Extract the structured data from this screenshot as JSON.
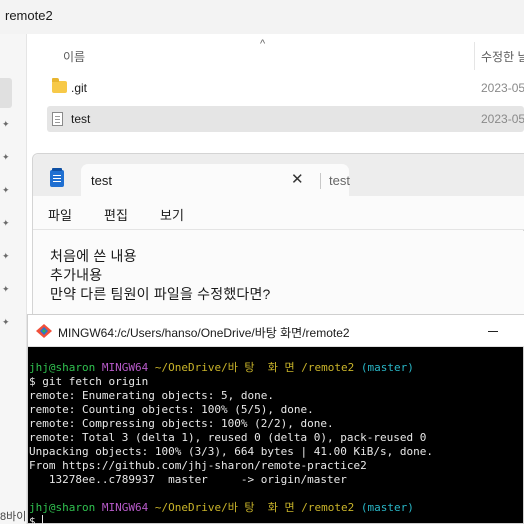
{
  "explorer": {
    "title": "remote2",
    "col_name": "이름",
    "col_modified": "수정한 날",
    "sort_caret": "^",
    "rows": [
      {
        "name": ".git",
        "date": "2023-05",
        "icon": "folder-icon"
      },
      {
        "name": "test",
        "date": "2023-05",
        "icon": "text-file-icon"
      }
    ],
    "nav_bottom_text": "8바이"
  },
  "notepad": {
    "tab_active": "test",
    "tab_close": "✕",
    "tab_inactive": "test",
    "menu": [
      "파일",
      "편집",
      "보기"
    ],
    "lines": [
      "처음에 쓴 내용",
      "추가내용",
      "만약 다른 팀원이 파일을 수정했다면?"
    ]
  },
  "terminal": {
    "title": "MINGW64:/c/Users/hanso/OneDrive/바탕 화면/remote2",
    "prompt_user": "jhj@sharon",
    "prompt_sys": "MINGW64",
    "prompt_path": "~/OneDrive/바 탕  화 면 /remote2",
    "prompt_branch": "(master)",
    "command": "$ git fetch origin",
    "output": [
      "remote: Enumerating objects: 5, done.",
      "remote: Counting objects: 100% (5/5), done.",
      "remote: Compressing objects: 100% (2/2), done.",
      "remote: Total 3 (delta 1), reused 0 (delta 0), pack-reused 0",
      "Unpacking objects: 100% (3/3), 664 bytes | 41.00 KiB/s, done.",
      "From https://github.com/jhj-sharon/remote-practice2",
      "   13278ee..c789937  master     -> origin/master"
    ],
    "prompt2_dollar": "$ "
  },
  "colors": {
    "term_bg": "#000000",
    "prompt_green": "#2fc14f",
    "prompt_purple": "#b75ac9",
    "prompt_yellow": "#c9b42a",
    "prompt_cyan": "#29b6c6",
    "notepad_accent": "#1f6fd1"
  }
}
